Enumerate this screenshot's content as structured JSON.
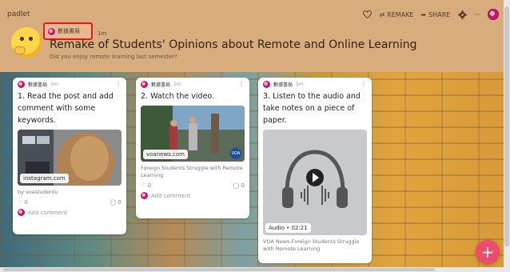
{
  "header": {
    "brand": "padlet",
    "remake_label": "REMAKE",
    "share_label": "SHARE",
    "more_label": "···",
    "author": "數據書局",
    "time": "1m",
    "title": "Remake of Students' Opinions about Remote and Online Learning",
    "subtitle": "Did you enjoy remote learning last semester?"
  },
  "cards": [
    {
      "author": "數據書局",
      "time": "1m",
      "title": "1. Read the post and add comment with some keywords.",
      "source": "instagram.com",
      "caption": "by voastudentu",
      "likes": "0",
      "comments": "0",
      "add_comment": "Add comment"
    },
    {
      "author": "數據書局",
      "time": "1m",
      "title": "2. Watch the video.",
      "source": "voanews.com",
      "caption": "Foreign Students Struggle with Remote Learning",
      "likes": "0",
      "comments": "0",
      "add_comment": "Add comment"
    },
    {
      "author": "數據書局",
      "time": "1m",
      "title": "3. Listen to the audio and take notes on a piece of paper.",
      "source": "Audio • 02:21",
      "caption": "VOA News-Foreign Students Struggle with Remote Learning"
    }
  ],
  "colors": {
    "header_bg": "#d9ac7d",
    "accent": "#ef4b6d",
    "highlight_box": "#e11b1b"
  }
}
